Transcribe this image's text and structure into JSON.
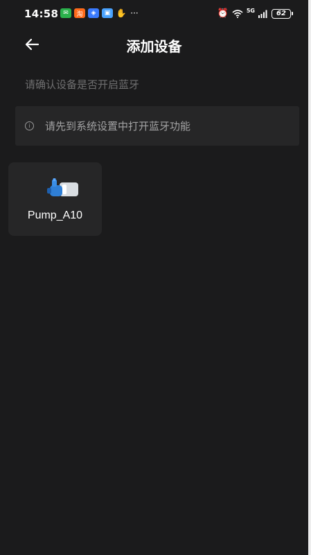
{
  "status_bar": {
    "time": "14:58",
    "notifications": [
      {
        "name": "wechat-icon",
        "glyph": "✉"
      },
      {
        "name": "taobao-icon",
        "glyph": "淘"
      },
      {
        "name": "app-store-icon",
        "glyph": "◈"
      },
      {
        "name": "cloud-app-icon",
        "glyph": "▣"
      },
      {
        "name": "hand-icon",
        "glyph": "✋"
      },
      {
        "name": "more-icon",
        "glyph": "···"
      }
    ],
    "network": "5G",
    "battery": "62"
  },
  "header": {
    "back_icon": "arrow-left-icon",
    "title": "添加设备"
  },
  "hint": "请确认设备是否开启蓝牙",
  "notice": {
    "icon": "info-icon",
    "icon_glyph": "i",
    "text": "请先到系统设置中打开蓝牙功能"
  },
  "devices": [
    {
      "name": "Pump_A10",
      "image": "pump-icon"
    }
  ],
  "colors": {
    "background": "#1b1b1c",
    "card": "#262627",
    "text_primary": "#ffffff",
    "text_secondary": "#6f6f70",
    "notice_text": "#a3a3a4"
  }
}
